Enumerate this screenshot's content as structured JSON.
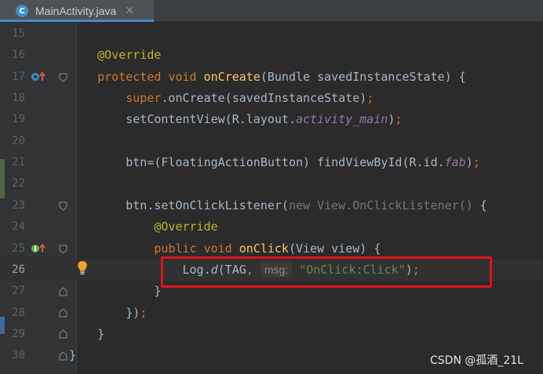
{
  "tab": {
    "label": "MainActivity.java",
    "icon_letter": "C",
    "icon": "java-class-icon",
    "close_icon": "close-icon"
  },
  "lines": [
    {
      "num": "15"
    },
    {
      "num": "16",
      "ann": "@Override"
    },
    {
      "num": "17",
      "kw1": "protected",
      "kw2": "void",
      "fn": "onCreate",
      "rest": "(Bundle savedInstanceState) {"
    },
    {
      "num": "18",
      "kw": "super",
      "rest": ".onCreate(savedInstanceState)",
      "semi": ";"
    },
    {
      "num": "19",
      "pre": "setContentView(R.layout.",
      "fld": "activity_main",
      "post": ")",
      "semi": ";"
    },
    {
      "num": "20"
    },
    {
      "num": "21",
      "pre": "btn=(FloatingActionButton) findViewById(R.id.",
      "fld": "fab",
      "post": ")",
      "semi": ";"
    },
    {
      "num": "22"
    },
    {
      "num": "23",
      "pre": "btn.setOnClickListener(",
      "dim": "new View.OnClickListener()",
      "post": " {"
    },
    {
      "num": "24",
      "ann": "@Override"
    },
    {
      "num": "25",
      "kw1": "public",
      "kw2": "void",
      "fn": "onClick",
      "rest": "(View view) {"
    },
    {
      "num": "26",
      "pre": "Log.",
      "mth": "d",
      "mid": "(TAG",
      "comma": ",",
      "hint": "msg:",
      "str": "\"OnClick:Click\"",
      "post": ")",
      "semi": ";"
    },
    {
      "num": "27",
      "text": "}"
    },
    {
      "num": "28",
      "text": "})",
      "semi": ";"
    },
    {
      "num": "29",
      "text": "}"
    },
    {
      "num": "30",
      "text": "}"
    }
  ],
  "gutter_icons": {
    "override_marker": "override-method-icon",
    "implement_marker": "implement-method-icon",
    "fold_marker": "fold-icon",
    "intention": "lightbulb-icon"
  },
  "watermark": "CSDN @孤酒_21L",
  "colors": {
    "background": "#2b2b2b",
    "keyword": "#cc7832",
    "annotation": "#bbb529",
    "method_decl": "#ffc66d",
    "field": "#9876aa",
    "string": "#6a8759",
    "highlight_box": "#e3121c"
  }
}
